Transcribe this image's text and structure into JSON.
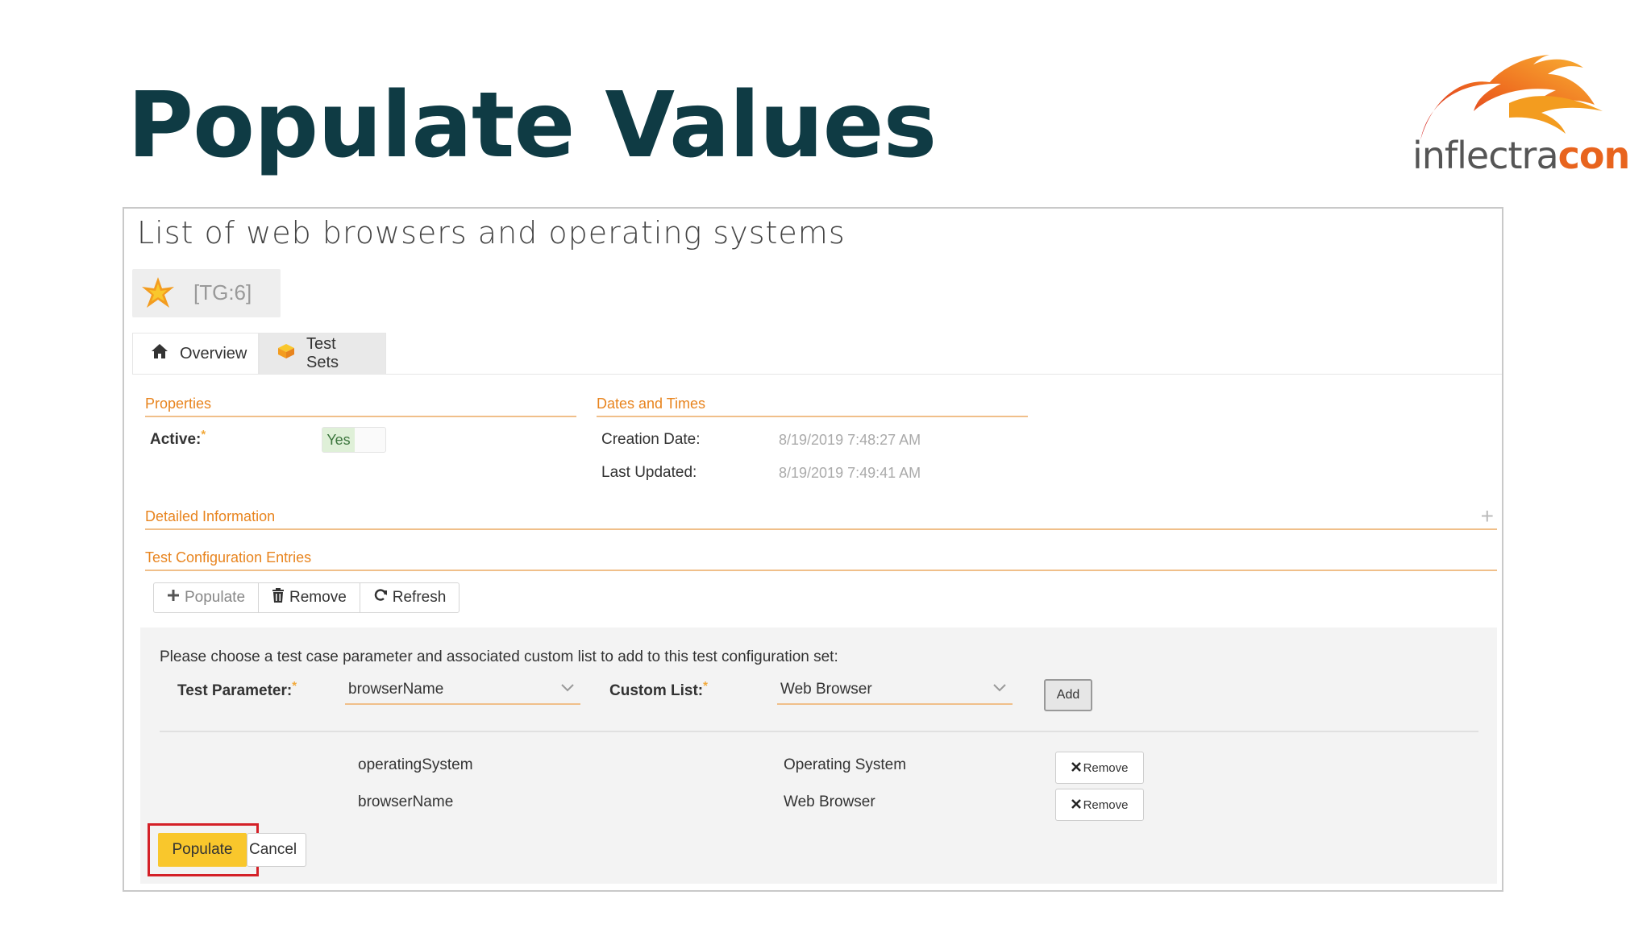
{
  "slide": {
    "title": "Populate Values"
  },
  "logo": {
    "text_part1": "inflectra",
    "text_part2": "con"
  },
  "artifact": {
    "title": "List of web browsers and operating systems",
    "id": "[TG:6]"
  },
  "tabs": [
    {
      "label": "Overview",
      "icon": "home-icon",
      "active": true
    },
    {
      "label": "Test Sets",
      "icon": "test-sets-icon",
      "active": false
    }
  ],
  "properties": {
    "heading": "Properties",
    "active_label": "Active:",
    "active_value": "Yes"
  },
  "dates": {
    "heading": "Dates and Times",
    "creation_label": "Creation Date:",
    "creation_value": "8/19/2019 7:48:27 AM",
    "updated_label": "Last Updated:",
    "updated_value": "8/19/2019 7:49:41 AM"
  },
  "detailed": {
    "heading": "Detailed Information",
    "expand_icon": "plus-icon"
  },
  "entries": {
    "heading": "Test Configuration Entries",
    "toolbar": {
      "populate": "Populate",
      "remove": "Remove",
      "refresh": "Refresh"
    }
  },
  "populate_panel": {
    "instructions": "Please choose a test case parameter and associated custom list to add to this test configuration set:",
    "param_label": "Test Parameter:",
    "param_value": "browserName",
    "list_label": "Custom List:",
    "list_value": "Web Browser",
    "add_label": "Add",
    "rows": [
      {
        "parameter": "operatingSystem",
        "list": "Operating System",
        "remove": "Remove"
      },
      {
        "parameter": "browserName",
        "list": "Web Browser",
        "remove": "Remove"
      }
    ],
    "populate_label": "Populate",
    "cancel_label": "Cancel"
  },
  "colors": {
    "title": "#0f3b44",
    "section_heading": "#e8841e",
    "populate_button": "#f9c72c",
    "highlight": "#d42027"
  }
}
